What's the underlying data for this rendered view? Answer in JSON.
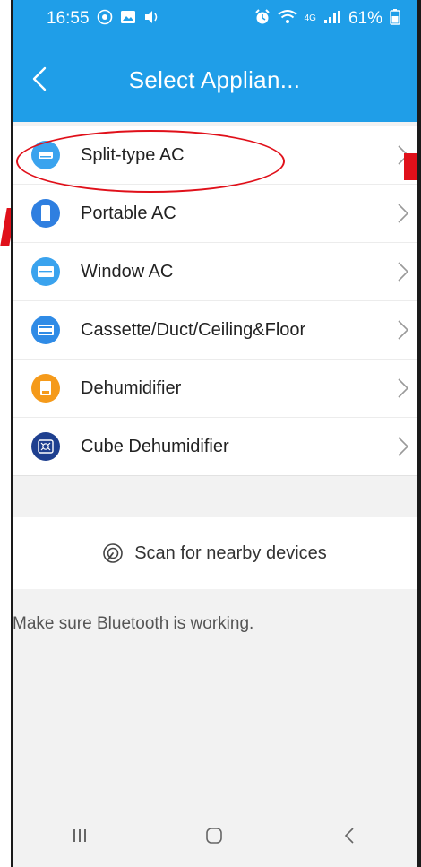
{
  "status_bar": {
    "time": "16:55",
    "battery": "61%",
    "network": "4G",
    "left_icons": [
      "chat-icon",
      "gallery-icon",
      "sound-icon"
    ],
    "right_icons": [
      "alarm-icon",
      "wifi-icon",
      "signal-icon",
      "battery-icon"
    ]
  },
  "header": {
    "title": "Select Applian...",
    "back_icon": "chevron-left-icon"
  },
  "appliances": [
    {
      "label": "Split-type AC",
      "icon": "split-ac-icon",
      "color": "#3aa3ee",
      "highlighted": true
    },
    {
      "label": "Portable AC",
      "icon": "portable-ac-icon",
      "color": "#2f7fe0"
    },
    {
      "label": "Window AC",
      "icon": "window-ac-icon",
      "color": "#3aa3ee"
    },
    {
      "label": "Cassette/Duct/Ceiling&Floor",
      "icon": "cassette-ac-icon",
      "color": "#2f8be6"
    },
    {
      "label": "Dehumidifier",
      "icon": "dehumidifier-icon",
      "color": "#f59a1a"
    },
    {
      "label": "Cube Dehumidifier",
      "icon": "cube-dehumidifier-icon",
      "color": "#1e3f8f"
    }
  ],
  "scan": {
    "label": "Scan for nearby devices",
    "icon": "scan-icon"
  },
  "hint": "Make sure Bluetooth is working.",
  "nav": {
    "recents_icon": "recents-icon",
    "home_icon": "home-icon",
    "back_icon": "back-icon"
  },
  "colors": {
    "accent": "#1f9ee8",
    "annotation": "#e0101a"
  }
}
